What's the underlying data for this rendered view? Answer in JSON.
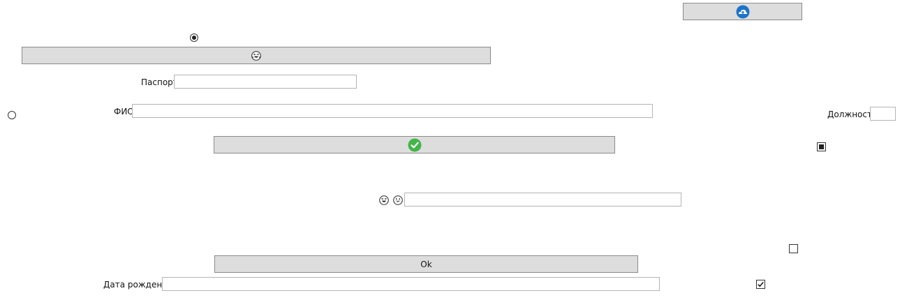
{
  "buttons": {
    "top_right_icon": "cloud-upload-icon",
    "emoji_button_icon": "laughing-face-icon",
    "confirm_button_icon": "check-circle-icon",
    "ok_label": "Ok"
  },
  "labels": {
    "passport": "Паспорт",
    "fio": "ФИО",
    "position": "Должность",
    "birth_date": "Дата рождения"
  },
  "fields": {
    "passport_value": "",
    "fio_value": "",
    "position_value": "",
    "emoji_field_value": "",
    "birth_date_value": ""
  },
  "emoji_label_icons": [
    "laughing-face-icon",
    "grinning-face-icon"
  ],
  "controls": {
    "radio_top_selected": true,
    "radio_left_selected": false,
    "checkbox_indeterminate_state": "indeterminate",
    "checkbox_empty_checked": false,
    "checkbox_checked": true
  },
  "colors": {
    "button_bg": "#dddddd",
    "upload_icon": "#1e73c8",
    "check_icon": "#43b549"
  }
}
